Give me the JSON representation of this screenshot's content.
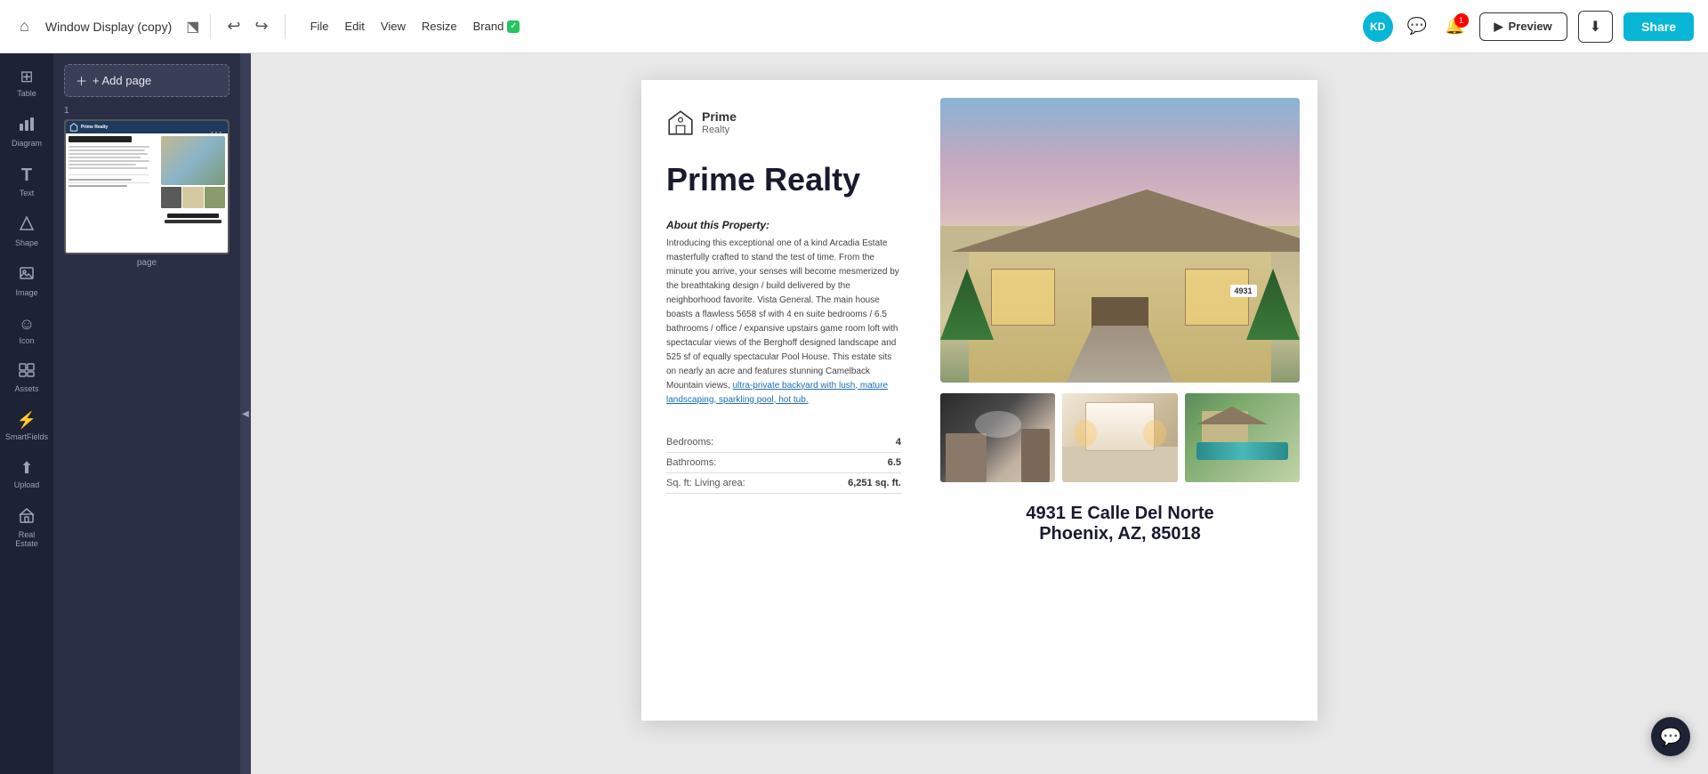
{
  "topbar": {
    "doc_title": "Window Display (copy)",
    "menu_items": [
      "File",
      "Edit",
      "View",
      "Resize",
      "Brand"
    ],
    "brand_label": "Brand",
    "preview_label": "Preview",
    "download_label": "↓",
    "share_label": "Share",
    "avatar_initials": "KD",
    "notif_count": "1"
  },
  "sidebar": {
    "items": [
      {
        "id": "table",
        "icon": "⊞",
        "label": "Table"
      },
      {
        "id": "diagram",
        "icon": "📊",
        "label": "Diagram"
      },
      {
        "id": "text",
        "icon": "T",
        "label": "Text"
      },
      {
        "id": "shape",
        "icon": "⬡",
        "label": "Shape"
      },
      {
        "id": "image",
        "icon": "🖼",
        "label": "Image"
      },
      {
        "id": "icon",
        "icon": "☺",
        "label": "Icon"
      },
      {
        "id": "assets",
        "icon": "◻",
        "label": "Assets"
      },
      {
        "id": "smartfields",
        "icon": "⚡",
        "label": "SmartFields"
      },
      {
        "id": "upload",
        "icon": "⬆",
        "label": "Upload"
      },
      {
        "id": "realestate",
        "icon": "🏢",
        "label": "Real Estate"
      }
    ]
  },
  "pages_panel": {
    "add_page_label": "+ Add page",
    "page_number": "1",
    "page_label": "page"
  },
  "document": {
    "brand_name": "Prime",
    "brand_sub": "Realty",
    "main_title": "Prime Realty",
    "about_title": "About this Property:",
    "about_text": "Introducing this exceptional one of a kind Arcadia Estate masterfully crafted to stand the test of time. From the minute you arrive, your senses will become mesmerized by the breathtaking design / build delivered by the neighborhood favorite. Vista General. The main house boasts a flawless 5658 sf with 4 en suite bedrooms / 6.5 bathrooms / office / expansive upstairs game room loft with spectacular views of the Berghoff designed landscape and 525 sf of equally spectacular Pool House. This estate sits on nearly an acre and features stunning Camelback Mountain views, ultra-private backyard with lush, mature landscaping, sparkling pool, hot tub.",
    "specs": [
      {
        "label": "Bedrooms:",
        "value": "4"
      },
      {
        "label": "Bathrooms:",
        "value": "6.5"
      },
      {
        "label": "Sq. ft: Living area:",
        "value": "6,251 sq. ft."
      }
    ],
    "address_line1": "4931 E Calle Del Norte",
    "address_line2": "Phoenix, AZ, 85018"
  }
}
